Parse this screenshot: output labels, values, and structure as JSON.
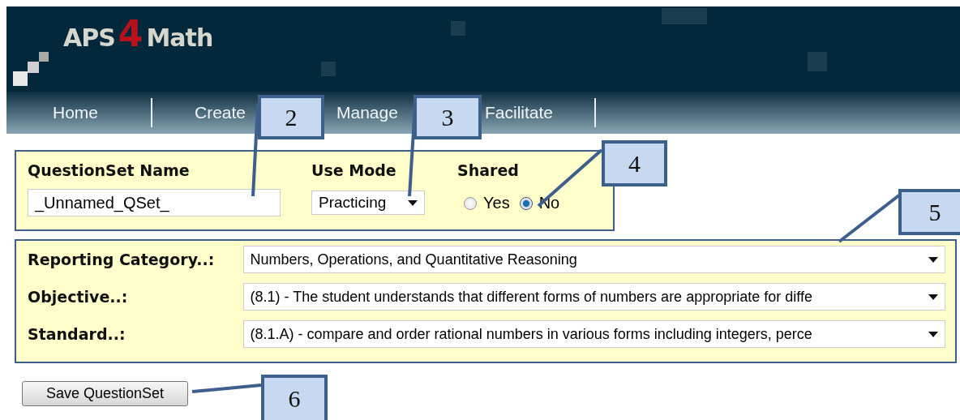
{
  "header": {
    "logo": {
      "left": "APS",
      "numeral": "4",
      "right": "Math"
    }
  },
  "nav": [
    {
      "label": "Home"
    },
    {
      "label": "Create"
    },
    {
      "label": "Manage"
    },
    {
      "label": "Facilitate"
    }
  ],
  "question_set": {
    "name_label": "QuestionSet Name",
    "name_value": "_Unnamed_QSet_",
    "mode_label": "Use Mode",
    "mode_value": "Practicing",
    "shared_label": "Shared",
    "shared_options": [
      {
        "label": "Yes",
        "selected": false
      },
      {
        "label": "No",
        "selected": true
      }
    ]
  },
  "filters": [
    {
      "label": "Reporting Category..:",
      "value": "Numbers, Operations, and Quantitative Reasoning"
    },
    {
      "label": "Objective..:",
      "value": "(8.1) - The student understands that different forms of numbers are appropriate for diffe"
    },
    {
      "label": "Standard..:",
      "value": "(8.1.A) - compare and order rational numbers in various forms including integers, perce"
    }
  ],
  "save_button": "Save QuestionSet",
  "callouts": [
    {
      "number": "2"
    },
    {
      "number": "3"
    },
    {
      "number": "4"
    },
    {
      "number": "5"
    },
    {
      "number": "6"
    }
  ]
}
